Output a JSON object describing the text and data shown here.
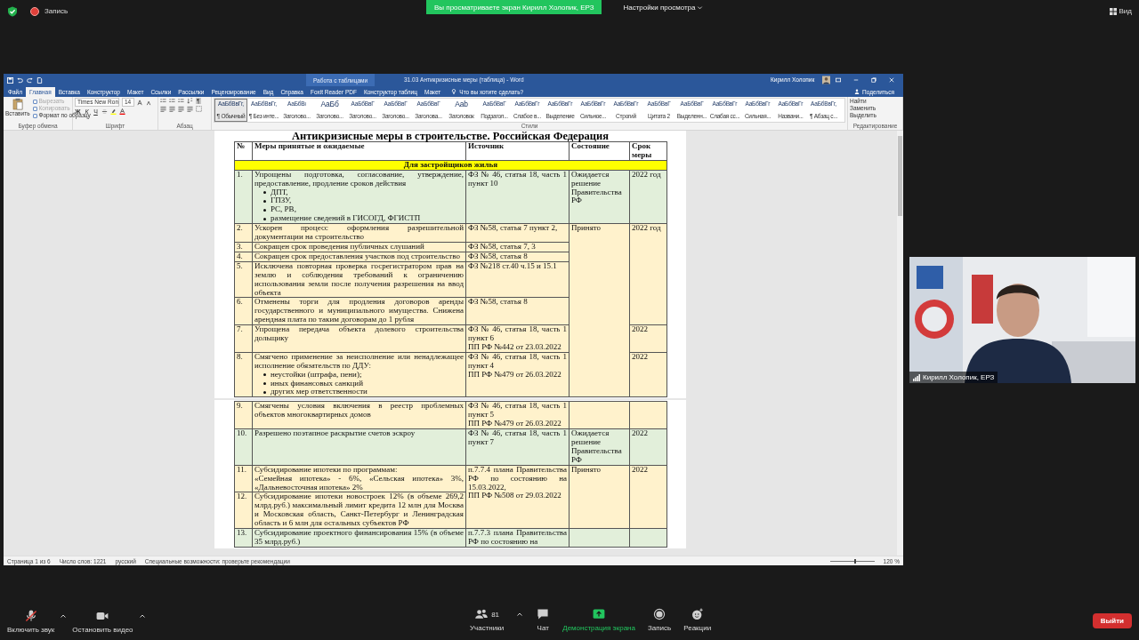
{
  "top_bar": {
    "recording": "Запись",
    "share_banner": "Вы просматриваете экран Кирилл Холопик, ЕРЗ",
    "view_options": "Настройки просмотра",
    "view_button": "Вид"
  },
  "word": {
    "context_title": "Работа с таблицами",
    "title": "31.03 Антикризисные меры (таблица) - Word",
    "user": "Кирилл Холопик",
    "tabs": [
      {
        "label": "Файл",
        "selected": false
      },
      {
        "label": "Главная",
        "selected": true
      },
      {
        "label": "Вставка",
        "selected": false
      },
      {
        "label": "Конструктор",
        "selected": false
      },
      {
        "label": "Макет",
        "selected": false
      },
      {
        "label": "Ссылки",
        "selected": false
      },
      {
        "label": "Рассылки",
        "selected": false
      },
      {
        "label": "Рецензирование",
        "selected": false
      },
      {
        "label": "Вид",
        "selected": false
      },
      {
        "label": "Справка",
        "selected": false
      },
      {
        "label": "Foxit Reader PDF",
        "selected": false
      },
      {
        "label": "Конструктор таблиц",
        "selected": false
      },
      {
        "label": "Макет",
        "selected": false
      }
    ],
    "tell_me": "Что вы хотите сделать?",
    "share": "Поделиться",
    "ribbon": {
      "clipboard": {
        "paste": "Вставить",
        "cut": {
          "label": "Вырезать",
          "disabled": true
        },
        "copy": {
          "label": "Копировать",
          "disabled": true
        },
        "format_painter": {
          "label": "Формат по образцу",
          "disabled": false
        },
        "label": "Буфер обмена"
      },
      "font": {
        "name": "Times New Ron",
        "size": "14",
        "format_buttons": [
          "Ж",
          "К",
          "Ч"
        ],
        "label": "Шрифт"
      },
      "paragraph": {
        "pilcrow": "¶",
        "label": "Абзац"
      },
      "styles": {
        "label": "Стили",
        "items": [
          {
            "preview": "АаБбВвГг,",
            "label": "¶ Обычный",
            "selected": true
          },
          {
            "preview": "АаБбВвГг,",
            "label": "¶ Без инте...",
            "selected": false
          },
          {
            "preview": "АаБбВı",
            "label": "Заголово...",
            "selected": false
          },
          {
            "preview": "АаБб",
            "label": "Заголово...",
            "selected": false
          },
          {
            "preview": "АаБбВвГ",
            "label": "Заголово...",
            "selected": false
          },
          {
            "preview": "АаБбВвГ",
            "label": "Заголово...",
            "selected": false
          },
          {
            "preview": "АаБбВвГ",
            "label": "Заголова...",
            "selected": false
          },
          {
            "preview": "Aab",
            "label": "Заголовок",
            "selected": false
          },
          {
            "preview": "АаБбВвГ",
            "label": "Подзагол...",
            "selected": false
          },
          {
            "preview": "АаБбВвГг",
            "label": "Слабое в...",
            "selected": false
          },
          {
            "preview": "АаБбВвГг",
            "label": "Выделение",
            "selected": false
          },
          {
            "preview": "АаБбВвГг",
            "label": "Сильное...",
            "selected": false
          },
          {
            "preview": "АаБбВвГг",
            "label": "Строгий",
            "selected": false
          },
          {
            "preview": "АаБбВвГ",
            "label": "Цитата 2",
            "selected": false
          },
          {
            "preview": "АаБбВвГ",
            "label": "Выделенн...",
            "selected": false
          },
          {
            "preview": "АаБбВвГг",
            "label": "Слабая сс...",
            "selected": false
          },
          {
            "preview": "АаБбВвГг",
            "label": "Сильная...",
            "selected": false
          },
          {
            "preview": "АаБбВвГг",
            "label": "Названи...",
            "selected": false
          },
          {
            "preview": "АаБбВвГг,",
            "label": "¶ Абзац с...",
            "selected": false
          }
        ]
      },
      "editing": {
        "find": "Найти",
        "replace": "Заменить",
        "select": "Выделить",
        "label": "Редактирование"
      }
    },
    "document": {
      "title": "Антикризисные меры в строительстве. Российская Федерация",
      "columns": [
        "№",
        "Меры принятые и ожидаемые",
        "Источник",
        "Состояние",
        "Срок меры"
      ],
      "pages": [
        {
          "section": "Для застройщиков жилья",
          "rows": [
            {
              "number": "1.",
              "measure": [
                "Упрощены подготовка, согласование, утверждение, предоставление, продление сроков действия"
              ],
              "bullets": [
                "ДПТ,",
                "ГПЗУ,",
                "РС, РВ,",
                "размещение сведений в ГИСОГД, ФГИСТП"
              ],
              "source": [
                "ФЗ № 46, статья 18, часть 1 пункт 10"
              ],
              "status": "Ожидается решение Правительства РФ",
              "term": "2022 год",
              "color": "#e2efda"
            },
            {
              "number": "2.",
              "measure": [
                "Ускорен процесс оформления разрешительной документации на строительство"
              ],
              "source": [
                "ФЗ №58, статья 7 пункт 2,"
              ],
              "status": "Принято",
              "term": "2022 год",
              "color": "#fff2cc"
            },
            {
              "number": "3.",
              "measure": [
                "Сокращен срок проведения публичных слушаний"
              ],
              "source": [
                "ФЗ №58, статья 7, 3"
              ],
              "color": "#fff2cc"
            },
            {
              "number": "4.",
              "measure": [
                "Сокращен срок предоставления участков под строительство"
              ],
              "source": [
                "ФЗ №58, статья 8"
              ],
              "color": "#fff2cc"
            },
            {
              "number": "5.",
              "measure": [
                "Исключена повторная проверка госрегистратором прав на землю и соблюдения требований к ограничению использования земли после получения разрешения на ввод объекта"
              ],
              "source": [
                "ФЗ №218 ст.40 ч.15 и 15.1"
              ],
              "color": "#fff2cc"
            },
            {
              "number": "6.",
              "measure": [
                "Отменены торги для продления договоров аренды государственного и муниципального имущества. Снижена арендная плата по таким договорам до 1 рубля"
              ],
              "source": [
                "ФЗ №58, статья 8"
              ],
              "color": "#fff2cc"
            },
            {
              "number": "7.",
              "measure": [
                "Упрощена передача объекта долевого строительства дольщику"
              ],
              "source": [
                "ФЗ № 46, статья 18, часть 1 пункт 6",
                "ПП РФ №442 от 23.03.2022"
              ],
              "term": "2022",
              "color": "#fff2cc"
            },
            {
              "number": "8.",
              "measure": [
                "Смягчено применение за неисполнение или ненадлежащее исполнение обязательств по ДДУ:"
              ],
              "bullets": [
                "неустойки (штрафа, пени);",
                "иных финансовых санкций",
                "других мер ответственности"
              ],
              "source": [
                "ФЗ № 46, статья 18, часть 1 пункт 4",
                "ПП РФ №479 от 26.03.2022"
              ],
              "term": "2022",
              "color": "#fff2cc"
            }
          ]
        },
        {
          "rows": [
            {
              "number": "9.",
              "measure": [
                "Смягчены условия включения в реестр проблемных объектов многоквартирных домов"
              ],
              "source": [
                "ФЗ № 46, статья 18, часть 1 пункт 5",
                "ПП РФ №479 от 26.03.2022"
              ],
              "status": null,
              "term": null,
              "color": "#fff2cc"
            },
            {
              "number": "10.",
              "measure": [
                "Разрешено поэтапное раскрытие счетов эскроу"
              ],
              "source": [
                "ФЗ № 46, статья 18, часть 1 пункт 7"
              ],
              "status": "Ожидается решение Правительства РФ",
              "term": "2022",
              "color": "#e2efda"
            },
            {
              "number": "11.",
              "measure": [
                "Субсидирование ипотеки по программам:",
                "«Семейная ипотека» - 6%, «Сельская ипотека» 3%, «Дальневосточная ипотека» 2%"
              ],
              "source": [
                "п.7.7.4 плана Правительства РФ по состоянию на 15.03.2022,",
                "ПП РФ №508 от 29.03.2022"
              ],
              "status": "Принято",
              "term": "2022",
              "color": "#fff2cc"
            },
            {
              "number": "12.",
              "measure": [
                "Субсидирование ипотеки новостроек 12% (в объеме 269,2 млрд.руб.) максимальный лимит кредита 12 млн для Москва и Московская область, Санкт-Петербург и Ленинградская область и 6 млн для остальных субъектов РФ"
              ],
              "color": "#fff2cc"
            },
            {
              "number": "13.",
              "measure": [
                "Субсидирование проектного финансирования 15% (в объеме 35 млрд.руб.)"
              ],
              "source": [
                "п.7.7.3 плана Правительства РФ по состоянию на"
              ],
              "status": null,
              "term": null,
              "color": "#e2efda"
            }
          ]
        }
      ]
    },
    "status_bar": {
      "page": "Страница 1 из 6",
      "words": "Число слов: 1221",
      "language": "русский",
      "accessibility": "Специальные возможности: проверьте рекомендации",
      "zoom": "120 %",
      "zoom_slider": {
        "level": 0.55
      }
    }
  },
  "video": {
    "name": "Кирилл Холопик, ЕРЗ"
  },
  "toolbar": {
    "items": [
      {
        "kind": "audio",
        "label": "Включить звук",
        "muted": true,
        "menu": true
      },
      {
        "kind": "video",
        "label": "Остановить видео",
        "menu": true
      },
      {
        "kind": "participants",
        "label": "Участники",
        "count": "81",
        "menu": true
      },
      {
        "kind": "chat",
        "label": "Чат"
      },
      {
        "kind": "share",
        "label": "Демонстрация экрана",
        "active": true
      },
      {
        "kind": "record",
        "label": "Запись"
      },
      {
        "kind": "reactions",
        "label": "Реакции"
      }
    ],
    "leave": "Выйти"
  }
}
